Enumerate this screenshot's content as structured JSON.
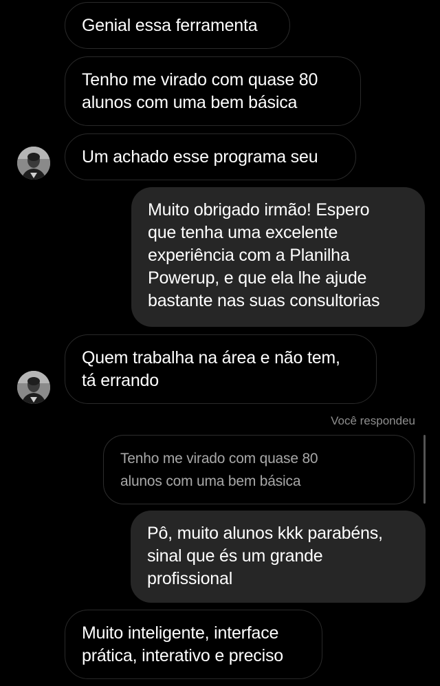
{
  "messages": [
    {
      "id": "m1",
      "sender": "them",
      "text": "Genial essa ferramenta"
    },
    {
      "id": "m2",
      "sender": "them",
      "text": "Tenho me virado com quase 80\nalunos com uma bem básica"
    },
    {
      "id": "m3",
      "sender": "them",
      "text": "Um achado esse programa seu"
    },
    {
      "id": "m4",
      "sender": "me",
      "text": "Muito obrigado irmão! Espero\nque tenha uma excelente\nexperiência com a Planilha\nPowerup, e que ela lhe ajude\nbastante nas suas consultorias"
    },
    {
      "id": "m5",
      "sender": "them",
      "text": "Quem trabalha na área e não tem,\ntá errando"
    },
    {
      "id": "m6",
      "sender": "me",
      "text": "Pô, muito alunos kkk parabéns,\nsinal que és um grande\nprofissional"
    },
    {
      "id": "m7",
      "sender": "them",
      "text": "Muito inteligente, interface\nprática, interativo e preciso"
    }
  ],
  "reply": {
    "label": "Você respondeu",
    "quoted_text": "Tenho me virado com quase 80\nalunos com uma bem básica"
  },
  "colors": {
    "background": "#000000",
    "outgoing_bubble": "#262626",
    "incoming_border": "#2a2a2a",
    "meta_text": "#8e8e8e",
    "quoted_text": "#a8a8a8"
  },
  "icons": {
    "avatar": "contact-avatar-icon"
  }
}
